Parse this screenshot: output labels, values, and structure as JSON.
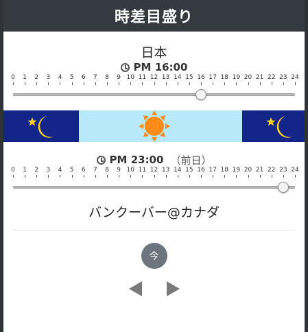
{
  "app": {
    "title": "時差目盛り"
  },
  "origin": {
    "city": "日本",
    "time": "PM 16:00",
    "hour": 16
  },
  "target": {
    "city": "バンクーバー@カナダ",
    "time": "PM 23:00",
    "day_note": "（前日）",
    "hour": 23
  },
  "scale": {
    "ticks": [
      "0",
      "1",
      "2",
      "3",
      "4",
      "5",
      "6",
      "7",
      "8",
      "9",
      "10",
      "11",
      "12",
      "13",
      "14",
      "15",
      "16",
      "17",
      "18",
      "19",
      "20",
      "21",
      "22",
      "23",
      "24"
    ],
    "max": 24
  },
  "band": {
    "segments": [
      "night",
      "day",
      "night"
    ],
    "day_start": 6,
    "day_end": 19
  },
  "controls": {
    "now_label": "今",
    "prev_icon": "triangle-left-icon",
    "next_icon": "triangle-right-icon"
  },
  "colors": {
    "header_bg": "#343a40",
    "night": "#14258a",
    "day": "#b8e9fb",
    "sun": "#ff8c1a",
    "moon": "#ffd21f",
    "button": "#6c757d"
  }
}
